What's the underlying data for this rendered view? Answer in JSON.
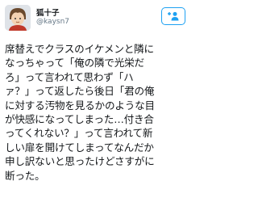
{
  "profile": {
    "display_name": "狐十子",
    "username": "@kaysn7",
    "avatar_icon": "avatar-illustration-icon"
  },
  "follow_button": {
    "icon": "add-user-icon",
    "color": "#1da1f2"
  },
  "tweet": {
    "text": "席替えでクラスのイケメンと隣に\nなっちゃって「俺の隣で光栄だ\nろ」って言われて思わず「ハ\nァ？」って返したら後日「君の俺\nに対する汚物を見るかのような目\nが快感になってしまった…付き合\nってくれない？」って言われて新\nしい扉を開けてしまってなんだか\n申し訳ないと思ったけどさすがに\n断った。"
  }
}
